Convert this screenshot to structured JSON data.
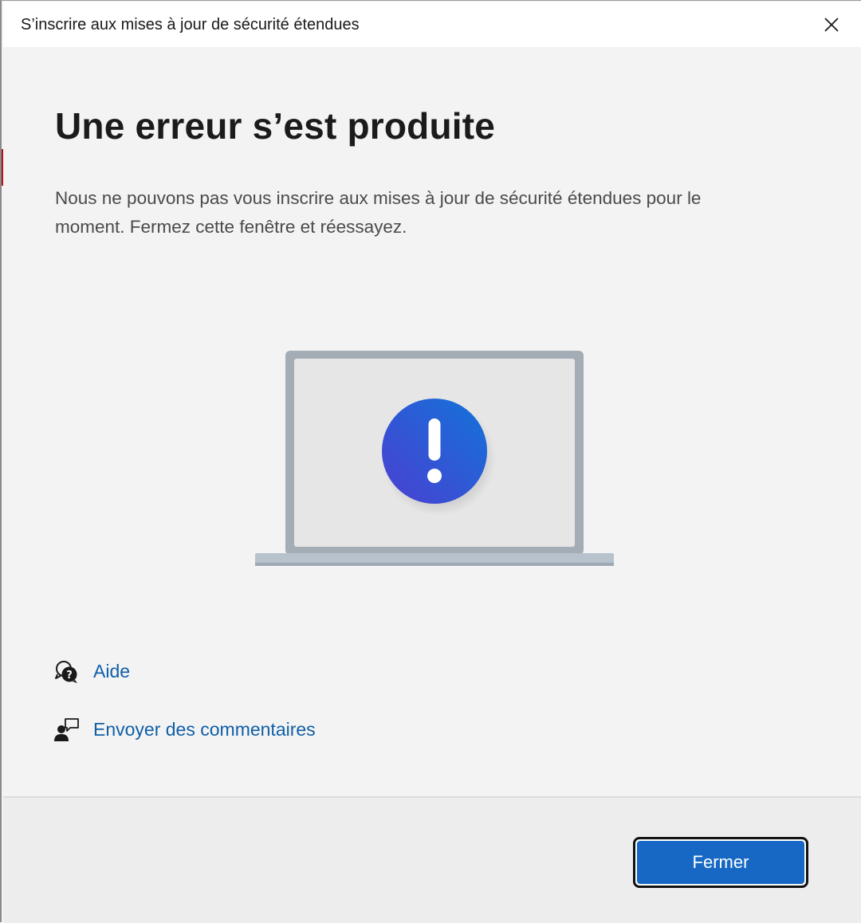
{
  "window": {
    "title": "S’inscrire aux mises à jour de sécurité étendues"
  },
  "main": {
    "heading": "Une erreur s’est produite",
    "description": "Nous ne pouvons pas vous inscrire aux mises à jour de sécurité étendues pour le moment. Fermez cette fenêtre et réessayez."
  },
  "illustration": {
    "icon": "laptop-error-illustration",
    "badge_icon": "exclamation-icon"
  },
  "links": [
    {
      "label": "Aide",
      "icon": "help-icon"
    },
    {
      "label": "Envoyer des commentaires",
      "icon": "feedback-icon"
    }
  ],
  "footer": {
    "close_label": "Fermer"
  },
  "colors": {
    "accent": "#1668c4",
    "link": "#0f5ea8",
    "background": "#f3f3f3"
  }
}
